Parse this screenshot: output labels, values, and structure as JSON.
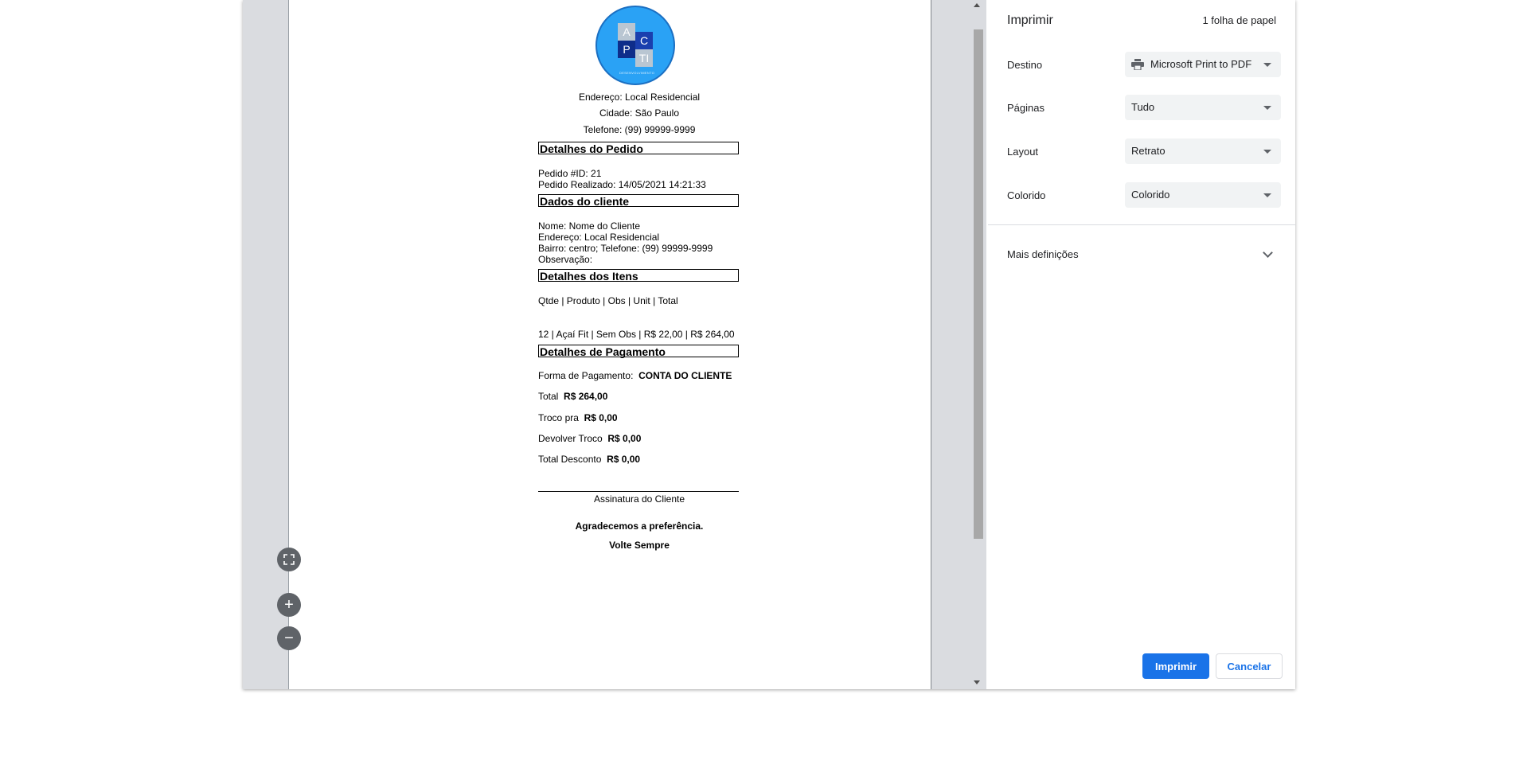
{
  "receipt": {
    "logo": {
      "letters": [
        "A",
        "C",
        "P",
        "TI"
      ],
      "tagline": "DESENVOLVIMENTO"
    },
    "address": "Endereço: Local Residencial",
    "city": "Cidade: São Paulo",
    "phone": "Telefone: (99) 99999-9999",
    "order_header": "Detalhes do Pedido",
    "order_id": "Pedido #ID: 21",
    "order_date": "Pedido Realizado: 14/05/2021 14:21:33",
    "client_header": "Dados do cliente",
    "client_name": "Nome: Nome do Cliente",
    "client_address": "Endereço: Local Residencial",
    "client_district": "Bairro: centro; Telefone: (99) 99999-9999",
    "client_note": "Observação:",
    "items_header": "Detalhes dos Itens",
    "items_columns": "Qtde | Produto | Obs | Unit | Total",
    "items_row": "12 | Açaí Fit | Sem Obs | R$ 22,00 | R$ 264,00",
    "payment_header": "Detalhes de Pagamento",
    "payment_method_label": "Forma de Pagamento:",
    "payment_method_value": "CONTA DO CLIENTE",
    "total_label": "Total",
    "total_value": "R$ 264,00",
    "change_for_label": "Troco pra",
    "change_for_value": "R$ 0,00",
    "return_change_label": "Devolver Troco",
    "return_change_value": "R$ 0,00",
    "discount_label": "Total Desconto",
    "discount_value": "R$ 0,00",
    "signature": "Assinatura do Cliente",
    "thanks": "Agradecemos a preferência.",
    "come_back": "Volte Sempre"
  },
  "zoom": {
    "fit_icon": "fit-to-page-icon",
    "plus": "+",
    "minus": "−"
  },
  "settings": {
    "title": "Imprimir",
    "sheets": "1 folha de papel",
    "destination_label": "Destino",
    "destination_value": "Microsoft Print to PDF",
    "pages_label": "Páginas",
    "pages_value": "Tudo",
    "layout_label": "Layout",
    "layout_value": "Retrato",
    "color_label": "Colorido",
    "color_value": "Colorido",
    "more_settings": "Mais definições",
    "print_button": "Imprimir",
    "cancel_button": "Cancelar"
  },
  "colors": {
    "accent": "#1a73e8",
    "logo_blue": "#2aa2f5"
  }
}
